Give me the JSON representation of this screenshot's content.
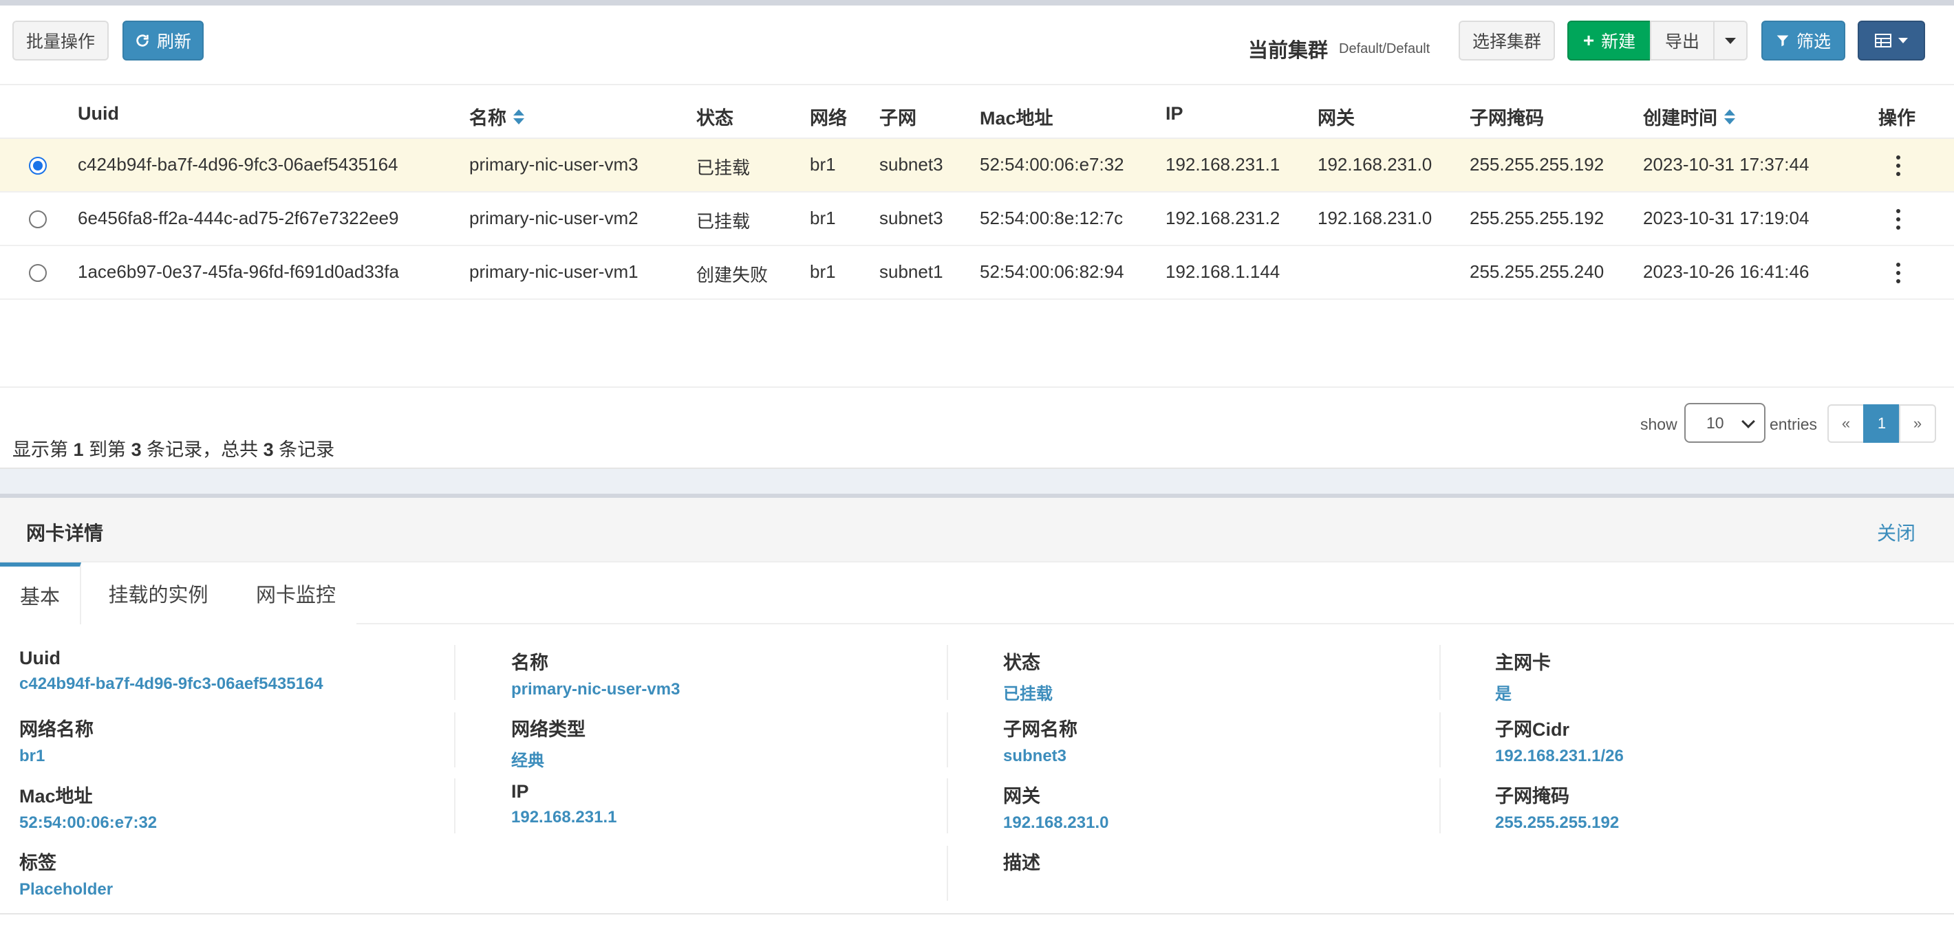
{
  "toolbar": {
    "batch_label": "批量操作",
    "refresh_label": "刷新",
    "cluster_label": "当前集群",
    "cluster_value": "Default/Default",
    "select_cluster_label": "选择集群",
    "new_label": "新建",
    "export_label": "导出",
    "filter_label": "筛选"
  },
  "table": {
    "headers": {
      "uuid": "Uuid",
      "name": "名称",
      "status": "状态",
      "network": "网络",
      "subnet": "子网",
      "mac": "Mac地址",
      "ip": "IP",
      "gateway": "网关",
      "netmask": "子网掩码",
      "created": "创建时间",
      "actions": "操作"
    },
    "rows": [
      {
        "uuid": "c424b94f-ba7f-4d96-9fc3-06aef5435164",
        "name": "primary-nic-user-vm3",
        "status": "已挂载",
        "network": "br1",
        "subnet": "subnet3",
        "mac": "52:54:00:06:e7:32",
        "ip": "192.168.231.1",
        "gateway": "192.168.231.0",
        "netmask": "255.255.255.192",
        "created": "2023-10-31 17:37:44",
        "selected": true
      },
      {
        "uuid": "6e456fa8-ff2a-444c-ad75-2f67e7322ee9",
        "name": "primary-nic-user-vm2",
        "status": "已挂载",
        "network": "br1",
        "subnet": "subnet3",
        "mac": "52:54:00:8e:12:7c",
        "ip": "192.168.231.2",
        "gateway": "192.168.231.0",
        "netmask": "255.255.255.192",
        "created": "2023-10-31 17:19:04",
        "selected": false
      },
      {
        "uuid": "1ace6b97-0e37-45fa-96fd-f691d0ad33fa",
        "name": "primary-nic-user-vm1",
        "status": "创建失败",
        "network": "br1",
        "subnet": "subnet1",
        "mac": "52:54:00:06:82:94",
        "ip": "192.168.1.144",
        "gateway": "",
        "netmask": "255.255.255.240",
        "created": "2023-10-26 16:41:46",
        "selected": false
      }
    ]
  },
  "footer": {
    "summary_pre": "显示第 ",
    "summary_from": "1",
    "summary_mid1": " 到第 ",
    "summary_to": "3",
    "summary_mid2": " 条记录，总共 ",
    "summary_total": "3",
    "summary_post": " 条记录",
    "show_label": "show",
    "page_size": "10",
    "entries_label": "entries",
    "prev": "«",
    "current_page": "1",
    "next": "»"
  },
  "detail": {
    "title": "网卡详情",
    "close_label": "关闭",
    "tabs": [
      "基本",
      "挂载的实例",
      "网卡监控"
    ],
    "fields": {
      "uuid_label": "Uuid",
      "uuid_value": "c424b94f-ba7f-4d96-9fc3-06aef5435164",
      "name_label": "名称",
      "name_value": "primary-nic-user-vm3",
      "status_label": "状态",
      "status_value": "已挂载",
      "primary_label": "主网卡",
      "primary_value": "是",
      "netname_label": "网络名称",
      "netname_value": "br1",
      "nettype_label": "网络类型",
      "nettype_value": "经典",
      "subnetname_label": "子网名称",
      "subnetname_value": "subnet3",
      "cidr_label": "子网Cidr",
      "cidr_value": "192.168.231.1/26",
      "mac_label": "Mac地址",
      "mac_value": "52:54:00:06:e7:32",
      "ip_label": "IP",
      "ip_value": "192.168.231.1",
      "gateway_label": "网关",
      "gateway_value": "192.168.231.0",
      "netmask_label": "子网掩码",
      "netmask_value": "255.255.255.192",
      "tags_label": "标签",
      "tags_value": "Placeholder",
      "desc_label": "描述",
      "desc_value": ""
    }
  },
  "colors": {
    "primary": "#3c8dbc",
    "success": "#00a65a",
    "dark": "#35608f",
    "selected_row": "#fcf8e3"
  }
}
